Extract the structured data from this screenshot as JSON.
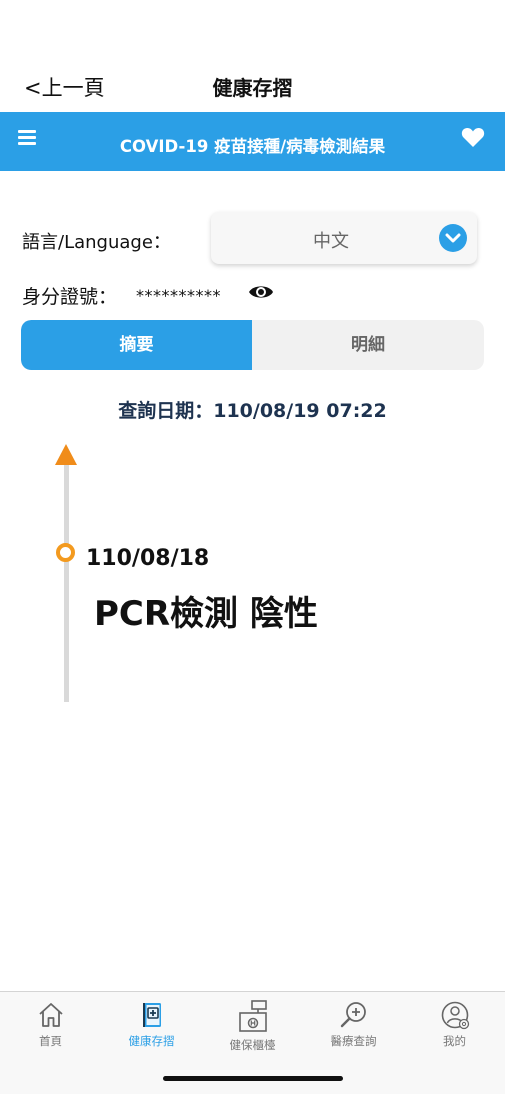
{
  "nav": {
    "back_label": "<上一頁",
    "title": "健康存摺"
  },
  "banner": {
    "menu_icon": "hamburger-menu-icon",
    "title": "COVID-19 疫苗接種/病毒檢測結果",
    "heart_icon": "heart-icon",
    "background_color": "#2b9fe6"
  },
  "language": {
    "label": "語言/Language：",
    "selected": "中文",
    "chevron_icon": "chevron-down-icon"
  },
  "identity": {
    "label": "身分證號：",
    "masked_value": "**********",
    "eye_icon": "eye-icon"
  },
  "tabs": {
    "summary": "摘要",
    "detail": "明細",
    "active": "summary"
  },
  "query_date": "查詢日期：110/08/19 07:22",
  "timeline": {
    "entries": [
      {
        "date": "110/08/18",
        "result": "PCR檢測 陰性"
      }
    ],
    "accent_color": "#f39a1f"
  },
  "bottom_nav": {
    "items": [
      {
        "label": "首頁",
        "icon": "home-icon"
      },
      {
        "label": "健康存摺",
        "icon": "health-book-icon",
        "active": true
      },
      {
        "label": "健保櫃檯",
        "icon": "insurance-counter-icon"
      },
      {
        "label": "醫療查詢",
        "icon": "medical-search-icon"
      },
      {
        "label": "我的",
        "icon": "user-settings-icon"
      }
    ]
  }
}
